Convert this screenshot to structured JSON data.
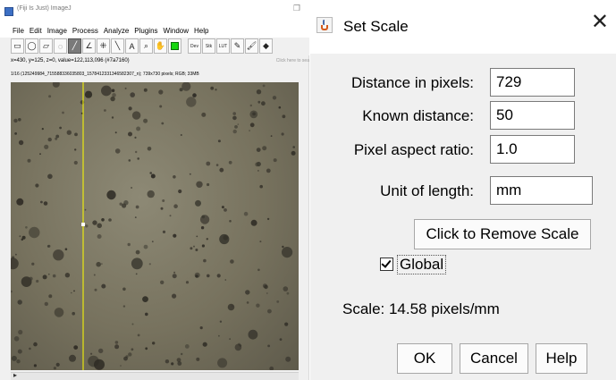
{
  "imagej": {
    "window_title": "(Fiji Is Just) ImageJ",
    "menu": [
      "File",
      "Edit",
      "Image",
      "Process",
      "Analyze",
      "Plugins",
      "Window",
      "Help"
    ],
    "tools": [
      {
        "icon": "rectangle-tool-icon",
        "glyph": "▭"
      },
      {
        "icon": "oval-tool-icon",
        "glyph": "◯"
      },
      {
        "icon": "polygon-tool-icon",
        "glyph": "▱"
      },
      {
        "icon": "freehand-tool-icon",
        "glyph": "◌"
      },
      {
        "icon": "line-tool-icon",
        "glyph": "╱"
      },
      {
        "icon": "angle-tool-icon",
        "glyph": "∠"
      },
      {
        "icon": "point-tool-icon",
        "glyph": "⁜"
      },
      {
        "icon": "wand-tool-icon",
        "glyph": "╲"
      },
      {
        "icon": "text-tool-icon",
        "glyph": "A"
      },
      {
        "icon": "magnifier-tool-icon",
        "glyph": "⌕"
      },
      {
        "icon": "hand-tool-icon",
        "glyph": "✋"
      },
      {
        "icon": "color-picker-icon",
        "glyph": ""
      },
      {
        "icon": "developer-menu-icon",
        "glyph": "Dev"
      },
      {
        "icon": "stacks-menu-icon",
        "glyph": "Stk"
      },
      {
        "icon": "lut-menu-icon",
        "glyph": "LUT"
      },
      {
        "icon": "pencil-tool-icon",
        "glyph": "✎"
      },
      {
        "icon": "brush-tool-icon",
        "glyph": "🖌"
      },
      {
        "icon": "flood-fill-tool-icon",
        "glyph": "◆"
      }
    ],
    "status": "x=430, y=125, z=0, value=122,113,096 (#7a7160)",
    "status_hint": "Click here to sea",
    "image_info": "1/16 (125249984_715588336035803_1578412331346582307_n); 739x730 pixels; RGB; 33MB",
    "colors": {
      "foreground": "#15d60f",
      "selection_line": "#ffff00"
    }
  },
  "dialog": {
    "title": "Set Scale",
    "fields": {
      "distance_pixels": {
        "label": "Distance in pixels:",
        "value": "729"
      },
      "known_distance": {
        "label": "Known distance:",
        "value": "50"
      },
      "aspect_ratio": {
        "label": "Pixel aspect ratio:",
        "value": "1.0"
      },
      "unit": {
        "label": "Unit of length:",
        "value": "mm"
      }
    },
    "remove_scale_label": "Click to Remove Scale",
    "global": {
      "label": "Global",
      "checked": true
    },
    "scale_text": "Scale: 14.58 pixels/mm",
    "buttons": {
      "ok": "OK",
      "cancel": "Cancel",
      "help": "Help"
    }
  }
}
